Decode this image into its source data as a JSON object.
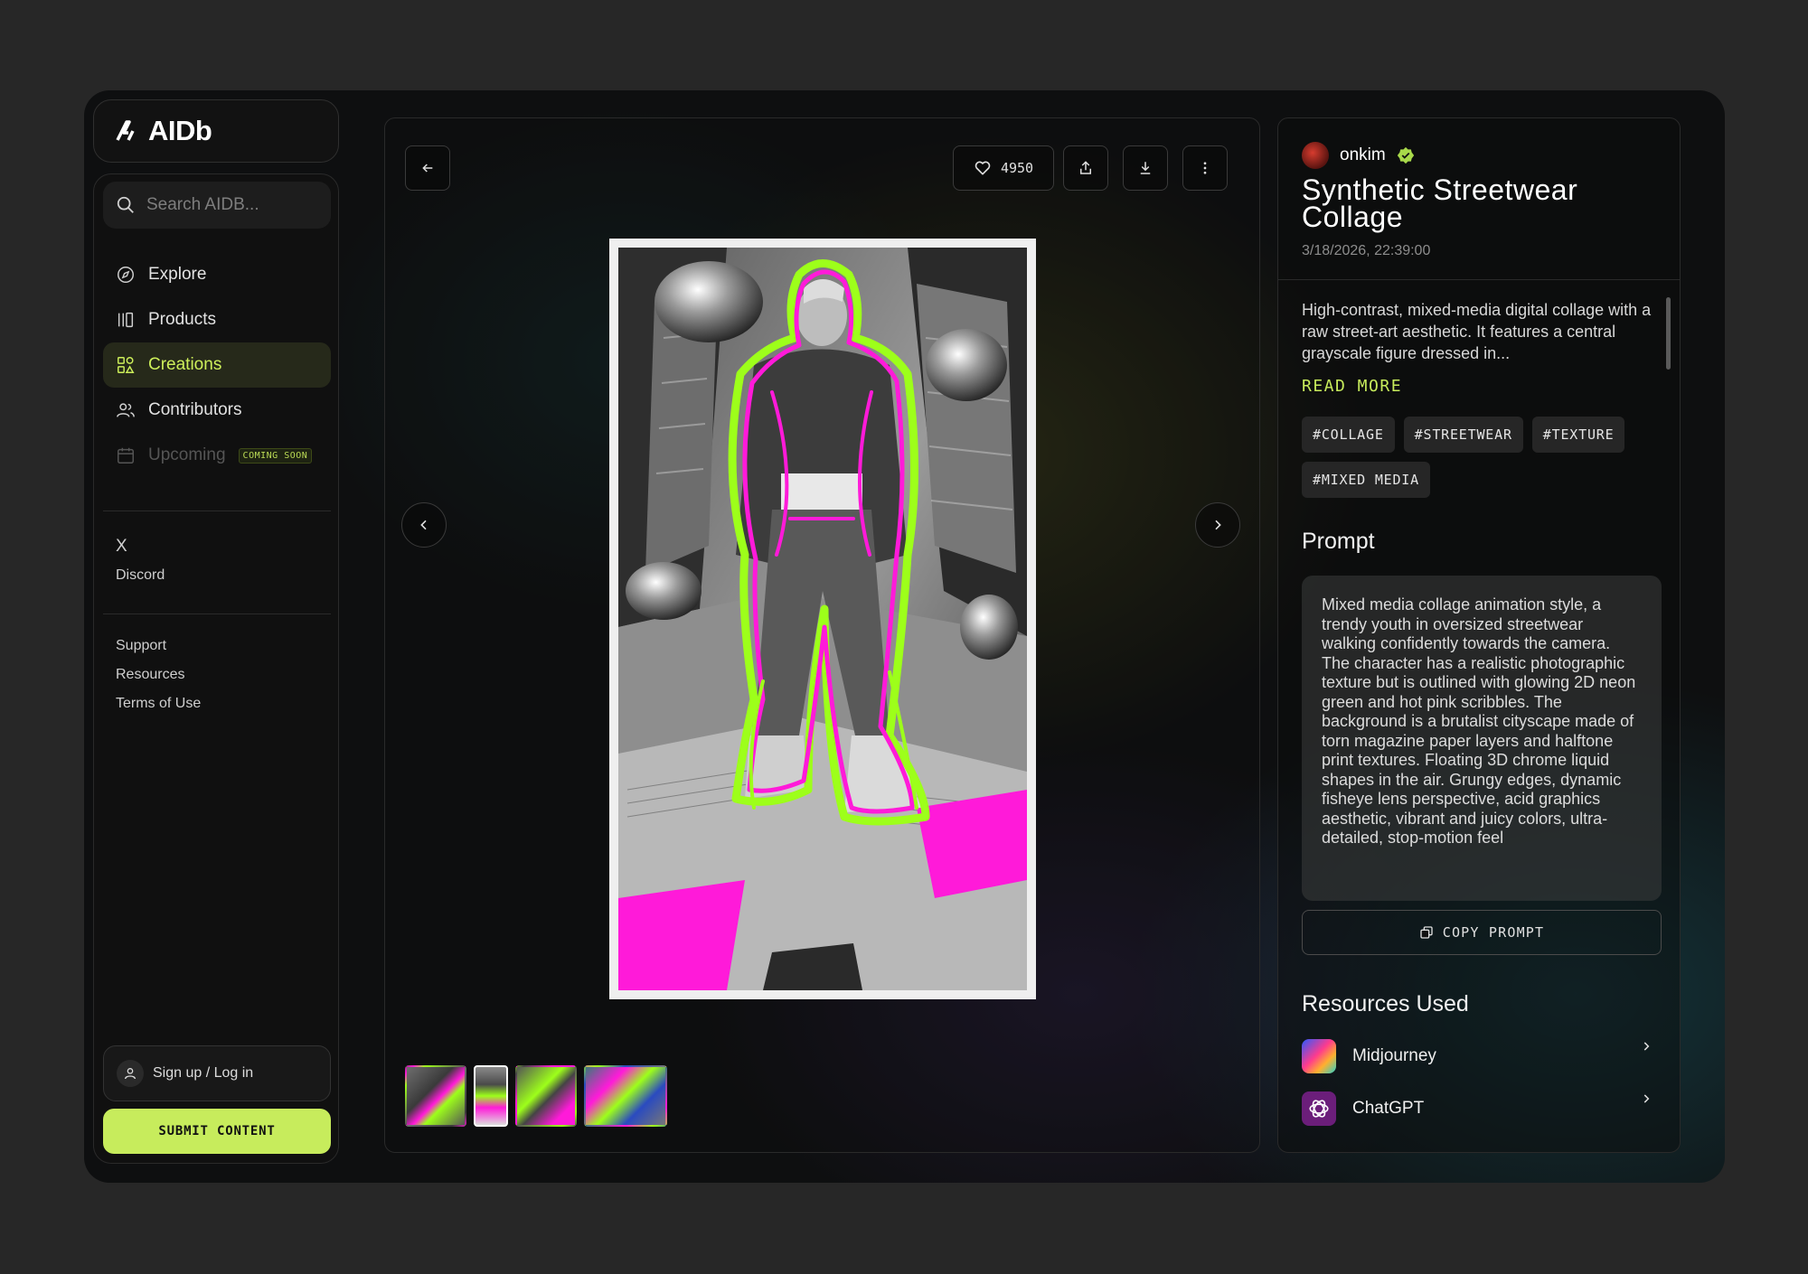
{
  "app": {
    "name": "AIDb"
  },
  "search": {
    "placeholder": "Search AIDB..."
  },
  "nav": {
    "items": [
      {
        "label": "Explore"
      },
      {
        "label": "Products"
      },
      {
        "label": "Creations"
      },
      {
        "label": "Contributors"
      },
      {
        "label": "Upcoming",
        "badge": "COMING SOON"
      }
    ]
  },
  "social": {
    "x_label": "X",
    "discord_label": "Discord"
  },
  "links": {
    "support": "Support",
    "resources": "Resources",
    "terms": "Terms of Use"
  },
  "auth": {
    "login_label": "Sign up / Log in"
  },
  "submit": {
    "label": "SUBMIT CONTENT"
  },
  "viewer": {
    "likes": "4950"
  },
  "post": {
    "author": "onkim",
    "title": "Synthetic Streetwear Collage",
    "date": "3/18/2026, 22:39:00",
    "description": "High-contrast, mixed-media digital collage with a raw street-art aesthetic. It features a central grayscale figure dressed in...",
    "read_more": "READ MORE",
    "tags": [
      "#COLLAGE",
      "#STREETWEAR",
      "#TEXTURE",
      "#MIXED MEDIA"
    ],
    "prompt_heading": "Prompt",
    "prompt": "Mixed media collage animation style, a trendy youth in oversized streetwear walking confidently towards the camera. The character has a realistic photographic texture but is outlined with glowing 2D neon green and hot pink scribbles. The background is a brutalist cityscape made of torn magazine paper layers and halftone print textures. Floating 3D chrome liquid shapes in the air. Grungy edges, dynamic fisheye lens perspective, acid graphics aesthetic, vibrant and juicy colors, ultra-detailed, stop-motion feel",
    "copy_label": "COPY PROMPT",
    "resources_heading": "Resources Used",
    "resources": [
      {
        "name": "Midjourney"
      },
      {
        "name": "ChatGPT"
      }
    ]
  },
  "colors": {
    "accent": "#c7ec5c",
    "neon_green": "#9dff1a",
    "hot_pink": "#ff1ad9"
  }
}
